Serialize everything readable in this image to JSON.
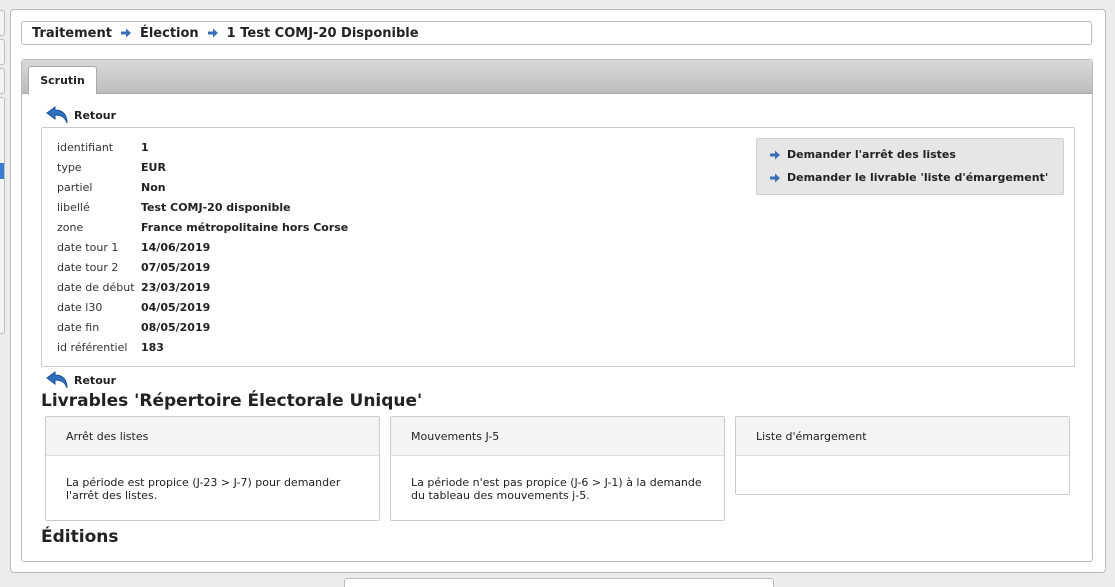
{
  "breadcrumb": {
    "items": [
      "Traitement",
      "Élection",
      "1 Test COMJ-20 Disponible"
    ]
  },
  "tabs": {
    "active_label": "Scrutin"
  },
  "back_label": "Retour",
  "fields": [
    {
      "label": "identifiant",
      "value": "1"
    },
    {
      "label": "type",
      "value": "EUR"
    },
    {
      "label": "partiel",
      "value": "Non"
    },
    {
      "label": "libellé",
      "value": "Test COMJ-20 disponible"
    },
    {
      "label": "zone",
      "value": "France métropolitaine hors Corse"
    },
    {
      "label": "date tour 1",
      "value": "14/06/2019"
    },
    {
      "label": "date tour 2",
      "value": "07/05/2019"
    },
    {
      "label": "date de début",
      "value": "23/03/2019"
    },
    {
      "label": "date l30",
      "value": "04/05/2019"
    },
    {
      "label": "date fin",
      "value": "08/05/2019"
    },
    {
      "label": "id référentiel",
      "value": "183"
    }
  ],
  "actions": [
    "Demander l'arrêt des listes",
    "Demander le livrable 'liste d'émargement'"
  ],
  "livrables": {
    "title": "Livrables 'Répertoire Électorale Unique'",
    "cards": [
      {
        "title": "Arrêt des listes",
        "body": "La période est propice (J-23 > J-7) pour demander l'arrêt des listes."
      },
      {
        "title": "Mouvements J-5",
        "body": "La période n'est pas propice (J-6 > J-1) à la demande du tableau des mouvements j-5."
      },
      {
        "title": "Liste d'émargement",
        "body": ""
      }
    ]
  },
  "editions": {
    "title": "Éditions"
  },
  "colors": {
    "accent_arrow": "#3a6fb5",
    "back_icon": "#2f6fc0"
  },
  "icons": {
    "breadcrumb_separator": "arrow-right-icon",
    "back": "back-arrow-icon",
    "action": "arrow-right-icon"
  }
}
